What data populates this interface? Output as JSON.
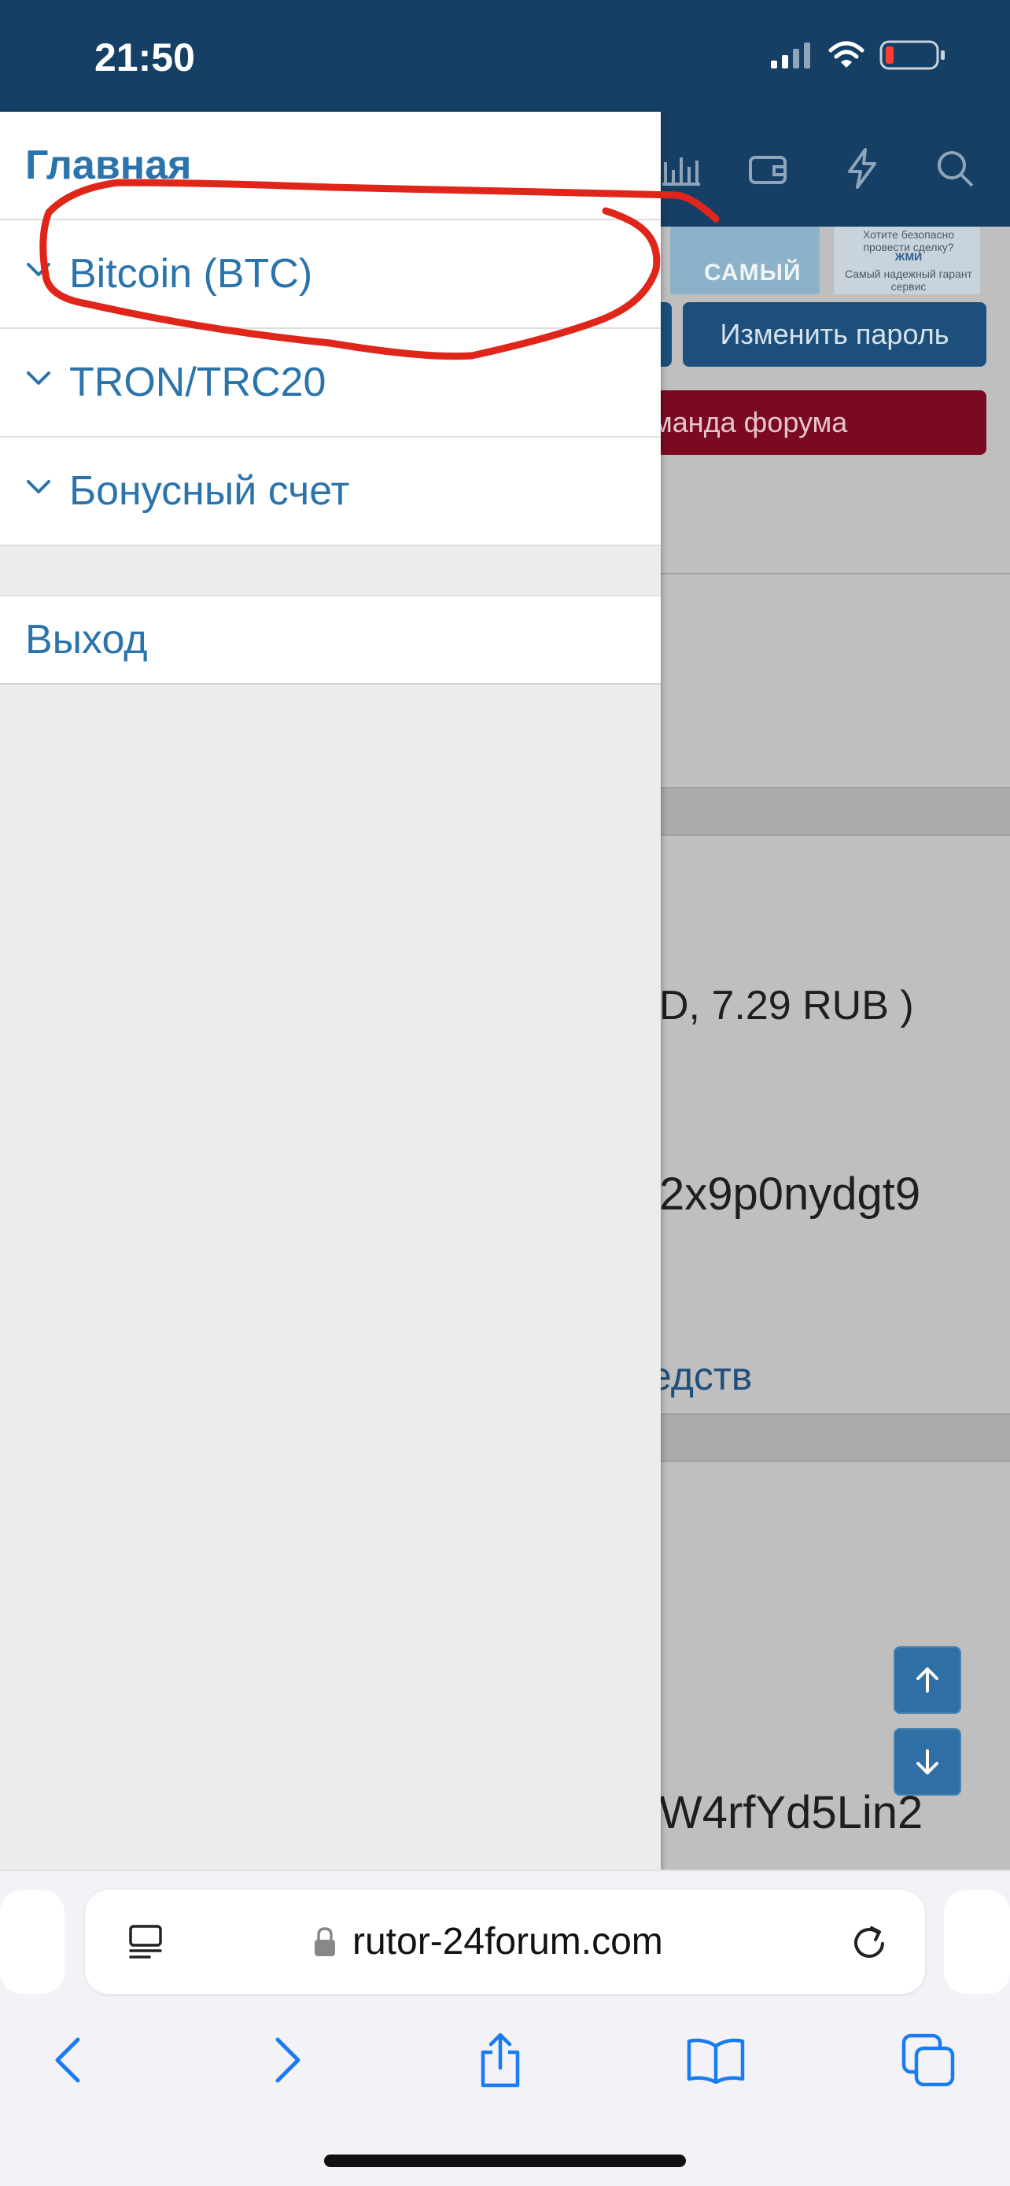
{
  "status_bar": {
    "time": "21:50"
  },
  "background_page": {
    "banner_text": "САМЫЙ",
    "banner_small_top": "Хотите безопасно провести сделку?",
    "banner_small_btn": "ЖМИ",
    "banner_small_bottom": "Самый надежный гарант сервис",
    "change_password_button": "Изменить пароль",
    "forum_team_text": "манда форума",
    "balance_fragment": "D, 7.29 RUB )",
    "address_fragment_1": "2x9p0nydgt9",
    "funds_link_fragment": "едств",
    "address_fragment_2": "W4rfYd5Lin2"
  },
  "drawer": {
    "home_label": "Главная",
    "items": [
      {
        "label": "Bitcoin (BTC)"
      },
      {
        "label": "TRON/TRC20"
      },
      {
        "label": "Бонусный счет"
      }
    ],
    "logout_label": "Выход"
  },
  "annotation": {
    "color": "#e0261a",
    "note": ""
  },
  "browser": {
    "url": "rutor-24forum.com"
  },
  "colors": {
    "header": "#163f66",
    "link": "#2b74ab",
    "drawer_bg": "#ececec"
  }
}
